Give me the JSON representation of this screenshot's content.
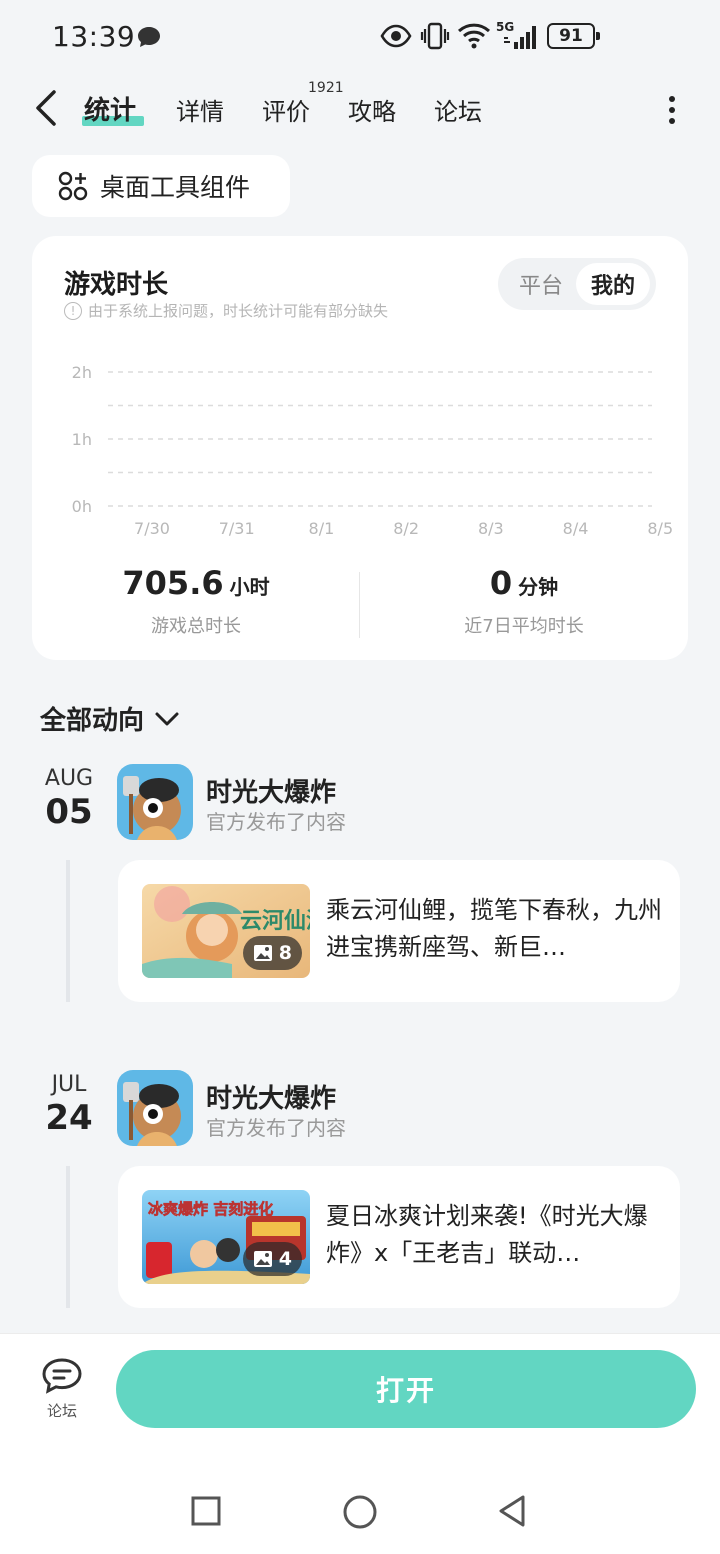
{
  "status_bar": {
    "time": "13:39",
    "network": "5G",
    "battery": "91",
    "icons": [
      "chat-bubble-icon",
      "eye-icon",
      "vibrate-icon",
      "wifi-icon",
      "signal-icon",
      "battery-icon"
    ]
  },
  "header": {
    "tabs": [
      {
        "label": "统计",
        "active": true
      },
      {
        "label": "详情",
        "active": false
      },
      {
        "label": "评价",
        "active": false,
        "badge": "1921"
      },
      {
        "label": "攻略",
        "active": false
      },
      {
        "label": "论坛",
        "active": false
      }
    ],
    "icons": [
      "back-arrow-icon",
      "more-vertical-icon"
    ]
  },
  "widget_button": {
    "label": "桌面工具组件",
    "icon": "grid-add-icon"
  },
  "stats_card": {
    "title": "游戏时长",
    "note": "由于系统上报问题，时长统计可能有部分缺失",
    "toggle": {
      "options": [
        "平台",
        "我的"
      ],
      "selected": "我的"
    },
    "total": {
      "value": "705.6",
      "unit": "小时",
      "label": "游戏总时长"
    },
    "average": {
      "value": "0",
      "unit": "分钟",
      "label": "近7日平均时长"
    }
  },
  "chart_data": {
    "type": "line",
    "categories": [
      "7/30",
      "7/31",
      "8/1",
      "8/2",
      "8/3",
      "8/4",
      "8/5"
    ],
    "y_ticks": [
      "2h",
      "1h",
      "0h"
    ],
    "ylim": [
      0,
      2
    ],
    "grid": true,
    "series": [
      {
        "values": [
          0,
          0,
          0,
          0,
          0,
          0,
          0
        ]
      }
    ]
  },
  "feed": {
    "filter_label": "全部动向",
    "items": [
      {
        "month": "AUG",
        "day": "05",
        "game_name": "时光大爆炸",
        "subtitle": "官方发布了内容",
        "post_text": "乘云河仙鲤，揽笔下春秋，九州进宝携新座驾、新巨…",
        "image_count": "8",
        "thumb_overlay": "云河仙济 录"
      },
      {
        "month": "JUL",
        "day": "24",
        "game_name": "时光大爆炸",
        "subtitle": "官方发布了内容",
        "post_text": "夏日冰爽计划来袭!《时光大爆炸》x「王老吉」联动…",
        "image_count": "4",
        "thumb_overlay": "冰爽爆炸 吉刻进化"
      }
    ]
  },
  "bottom_bar": {
    "forum_label": "论坛",
    "open_label": "打开",
    "accent": "#62d6c2"
  },
  "nav_bar": {
    "icons": [
      "recent-apps-icon",
      "home-icon",
      "back-icon"
    ]
  }
}
